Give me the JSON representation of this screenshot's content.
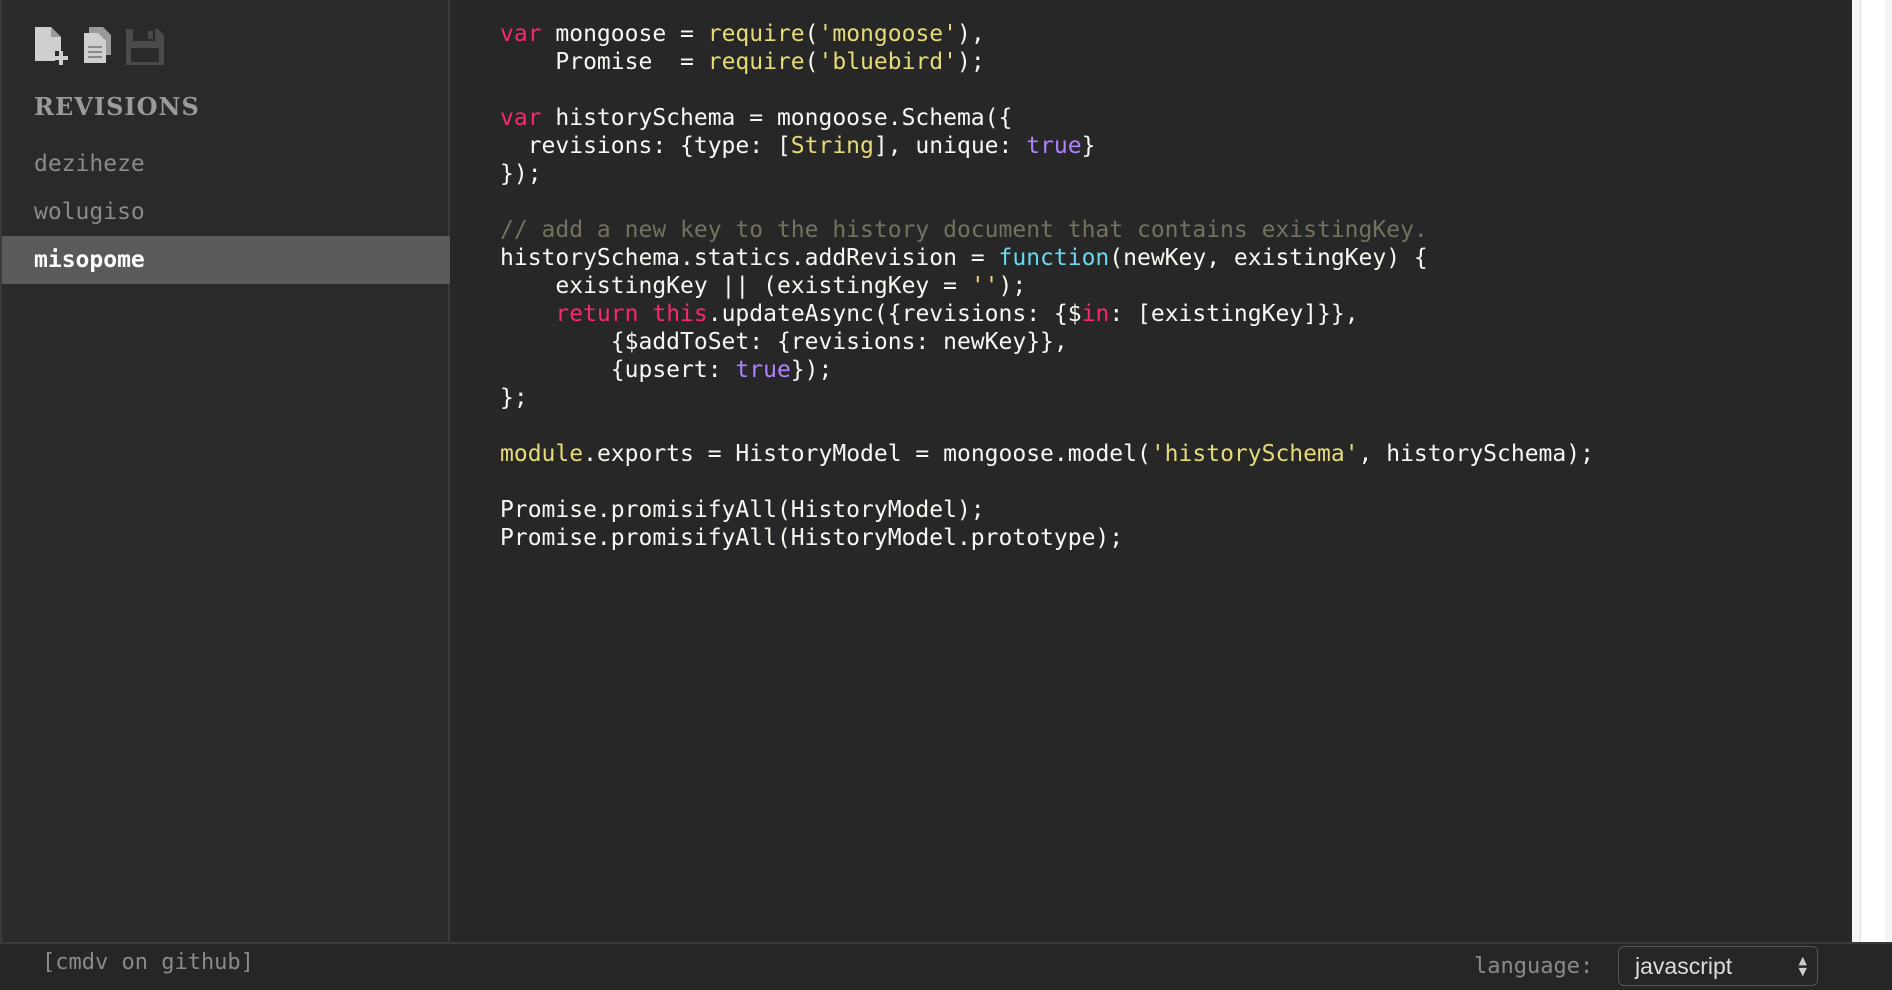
{
  "toolbar": {
    "icons": [
      "new-file-icon",
      "copy-file-icon",
      "save-icon"
    ],
    "icon_color": "#cfcfcf"
  },
  "sidebar": {
    "heading": "REVISIONS",
    "revisions": [
      {
        "label": "deziheze",
        "active": false
      },
      {
        "label": "wolugiso",
        "active": false
      },
      {
        "label": "misopome",
        "active": true
      }
    ]
  },
  "editor": {
    "language": "javascript",
    "lines": [
      "var mongoose = require('mongoose'),",
      "    Promise  = require('bluebird');",
      "",
      "var historySchema = mongoose.Schema({",
      "  revisions: {type: [String], unique: true}",
      "});",
      "",
      "// add a new key to the history document that contains existingKey.",
      "historySchema.statics.addRevision = function(newKey, existingKey) {",
      "    existingKey || (existingKey = '');",
      "    return this.updateAsync({revisions: {$in: [existingKey]}},",
      "        {$addToSet: {revisions: newKey}},",
      "        {upsert: true});",
      "};",
      "",
      "module.exports = HistoryModel = mongoose.model('historySchema', historySchema);",
      "",
      "Promise.promisifyAll(HistoryModel);",
      "Promise.promisifyAll(HistoryModel.prototype);"
    ]
  },
  "footer": {
    "github_link": "[cmdv on github]",
    "language_label": "language:",
    "language_selected": "javascript"
  },
  "colors": {
    "background": "#272727",
    "keyword": "#f92672",
    "string": "#e6db74",
    "boolean": "#ae81ff",
    "function": "#66d9ef",
    "comment": "#75715e",
    "active_revision_bg": "#5a5a5a"
  }
}
